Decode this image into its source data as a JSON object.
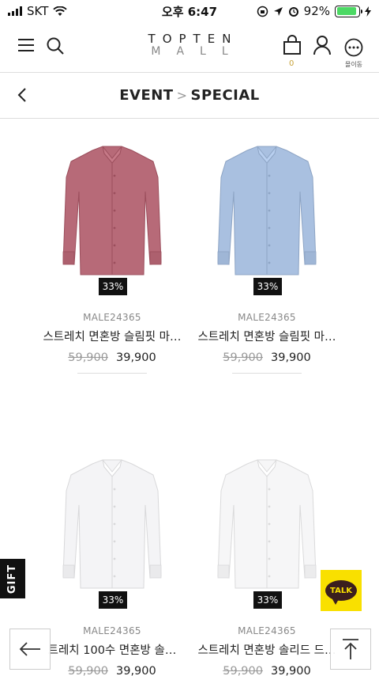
{
  "status_bar": {
    "carrier": "SKT",
    "time": "오후 6:47",
    "battery_percent": "92%",
    "battery_level": 0.92
  },
  "header": {
    "logo_top": "TOPTEN",
    "logo_bottom": "MALL",
    "cart_count": "0",
    "more_label": "몰이동"
  },
  "breadcrumb": {
    "parent": "EVENT",
    "separator": ">",
    "current": "SPECIAL"
  },
  "products": [
    {
      "badge": "33%",
      "code": "MALE24365",
      "name": "스트레치 면혼방 슬림핏 마…",
      "original_price": "59,900",
      "sale_price": "39,900",
      "shirt_color": "#b76a78"
    },
    {
      "badge": "33%",
      "code": "MALE24365",
      "name": "스트레치 면혼방 슬림핏 마…",
      "original_price": "59,900",
      "sale_price": "39,900",
      "shirt_color": "#a9c0e0"
    },
    {
      "badge": "33%",
      "code": "MALE24365",
      "name": "트레치 100수 면혼방 솔…",
      "original_price": "59,900",
      "sale_price": "39,900",
      "shirt_color": "#f4f4f6"
    },
    {
      "badge": "33%",
      "code": "MALE24365",
      "name": "스트레치 면혼방 솔리드 드…",
      "original_price": "59,900",
      "sale_price": "39,900",
      "shirt_color": "#f6f6f7"
    }
  ],
  "floating": {
    "gift_label": "GIFT",
    "talk_label": "TALK"
  },
  "colors": {
    "kakao_yellow": "#f9e000",
    "cart_count": "#c8a23a"
  }
}
